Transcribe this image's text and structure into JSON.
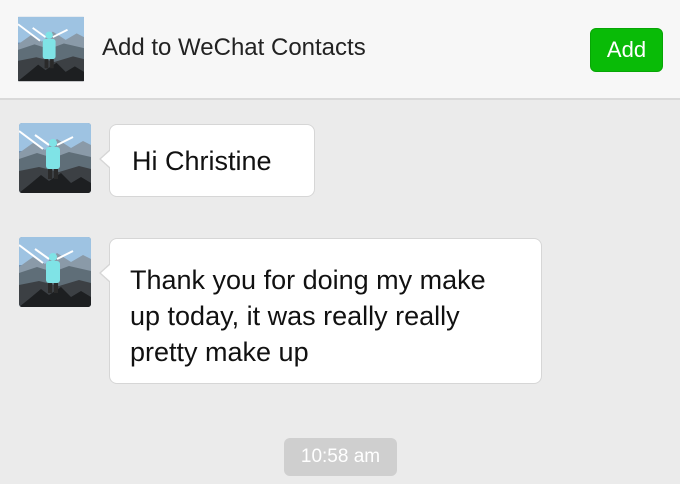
{
  "banner": {
    "text": "Add to WeChat Contacts",
    "add_label": "Add"
  },
  "messages": [
    {
      "text": "Hi Christine"
    },
    {
      "text": "Thank you for doing my make up today, it was really really pretty make up"
    }
  ],
  "timestamp": "10:58 am",
  "colors": {
    "add_button": "#09bb07",
    "background": "#ebebeb",
    "bubble": "#ffffff",
    "timestamp_pill": "#cfcfcf"
  }
}
